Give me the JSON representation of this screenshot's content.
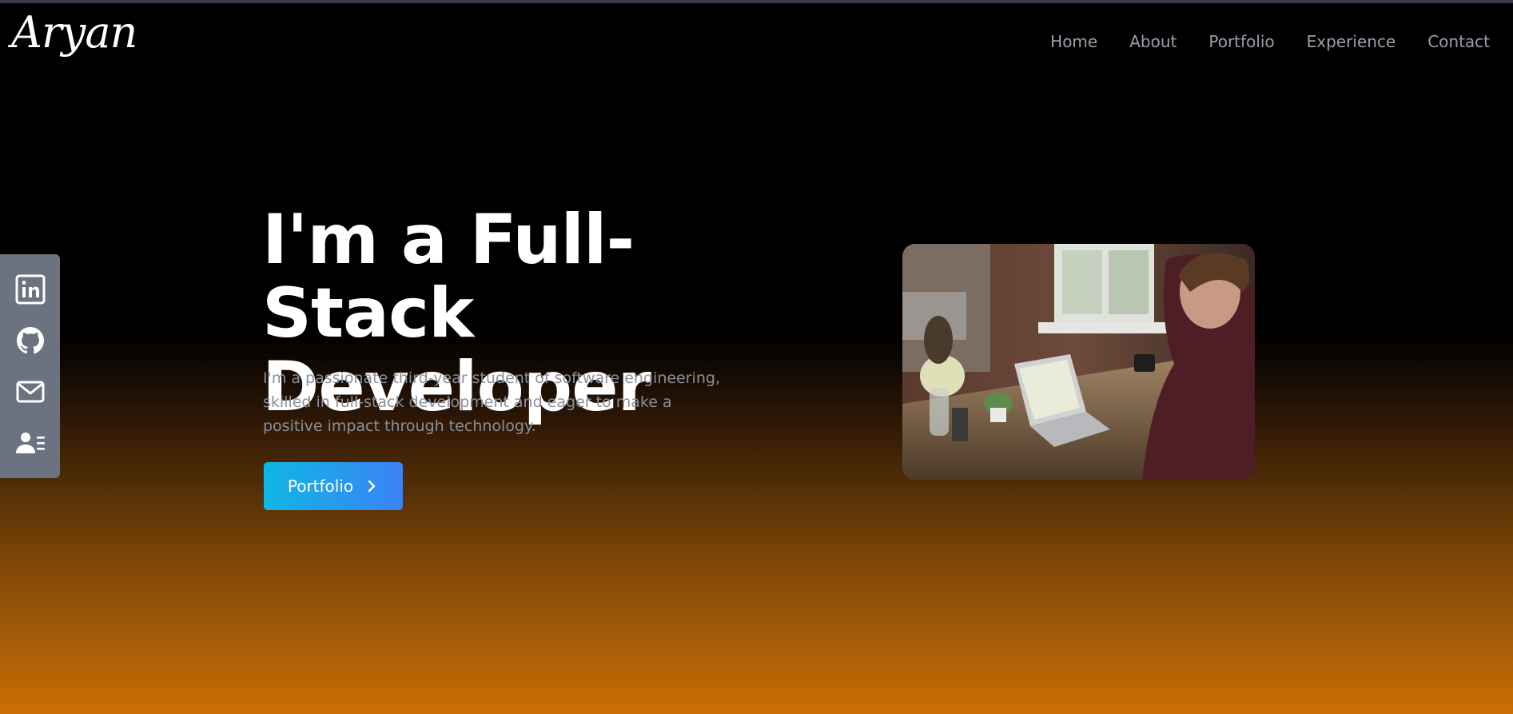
{
  "header": {
    "logo": "Aryan",
    "nav": [
      {
        "label": "Home"
      },
      {
        "label": "About"
      },
      {
        "label": "Portfolio"
      },
      {
        "label": "Experience"
      },
      {
        "label": "Contact"
      }
    ]
  },
  "social": [
    {
      "icon": "linkedin-icon"
    },
    {
      "icon": "github-icon"
    },
    {
      "icon": "mail-icon"
    },
    {
      "icon": "resume-icon"
    }
  ],
  "hero": {
    "title_line1": "I'm a Full-Stack",
    "title_line2": "Developer",
    "description": "I'm a passionate third-year student of software engineering, skilled in full-stack development and eager to make a positive impact through technology.",
    "cta_label": "Portfolio",
    "cta_icon": "chevron-right-icon",
    "image_alt": "person-working-on-laptop"
  },
  "colors": {
    "accent_start": "#0fb7e2",
    "accent_end": "#3b82f6",
    "gradient_bottom": "#cb6e06",
    "sidebar_bg": "#6b7280"
  }
}
